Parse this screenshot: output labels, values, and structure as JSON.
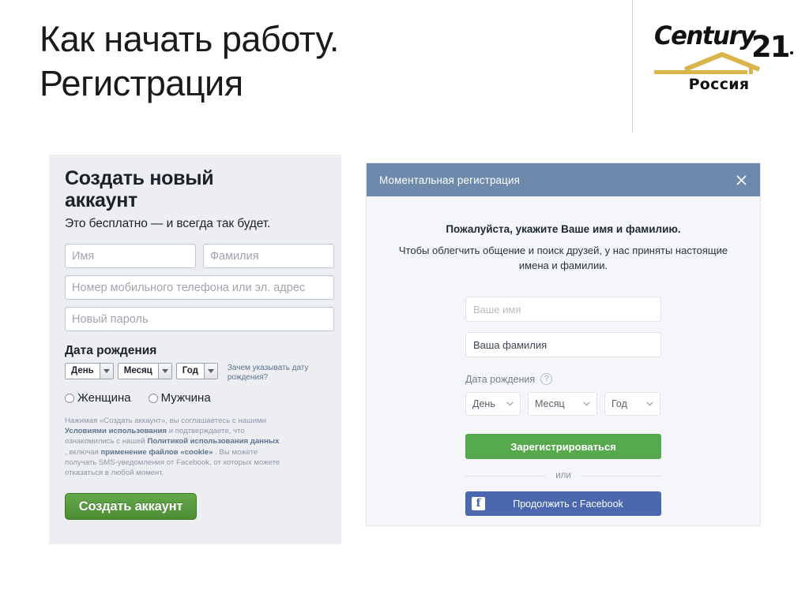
{
  "slide": {
    "title_line1": "Как начать работу.",
    "title_line2": "Регистрация"
  },
  "logo": {
    "wordmark_main": "Century",
    "wordmark_number": "21",
    "country": "Россия"
  },
  "left_panel": {
    "heading": "Создать новый аккаунт",
    "subheading": "Это бесплатно — и всегда так будет.",
    "firstname_placeholder": "Имя",
    "lastname_placeholder": "Фамилия",
    "contact_placeholder": "Номер мобильного телефона или эл. адрес",
    "password_placeholder": "Новый пароль",
    "dob_label": "Дата рождения",
    "dob_day": "День",
    "dob_month": "Месяц",
    "dob_year": "Год",
    "dob_why_link": "Зачем указывать дату рождения?",
    "gender_female": "Женщина",
    "gender_male": "Мужчина",
    "legal_part1": "Нажимая «Создать аккаунт», вы соглашаетесь с нашими ",
    "legal_link1": "Условиями использования",
    "legal_part2": " и подтверждаете, что ознакомились с нашей ",
    "legal_link2": "Политикой использования данных",
    "legal_part3": ", включая ",
    "legal_link3": "применение файлов «cookie»",
    "legal_part4": ". Вы можете получать SMS-уведомления от Facebook, от которых можете отказаться в любой момент.",
    "submit_label": "Создать аккаунт",
    "accent_green": "#4d8c33",
    "panel_bg": "#edeef2"
  },
  "right_panel": {
    "modal_title": "Моментальная регистрация",
    "close_icon": "close-icon",
    "lead_text": "Пожалуйста, укажите Ваше имя и фамилию.",
    "description": "Чтобы облегчить общение и поиск друзей, у нас приняты настоящие имена и фамилии.",
    "firstname_placeholder": "Ваше имя",
    "lastname_value": "Ваша фамилия",
    "dob_label": "Дата рождения",
    "help_icon_glyph": "?",
    "dob_day": "День",
    "dob_month": "Месяц",
    "dob_year": "Год",
    "signup_label": "Зарегистрироваться",
    "or_label": "или",
    "facebook_label": "Продолжить с Facebook",
    "facebook_icon_glyph": "f",
    "header_blue": "#6d8aad",
    "accent_green": "#57a94d",
    "facebook_blue": "#4b67ae"
  }
}
